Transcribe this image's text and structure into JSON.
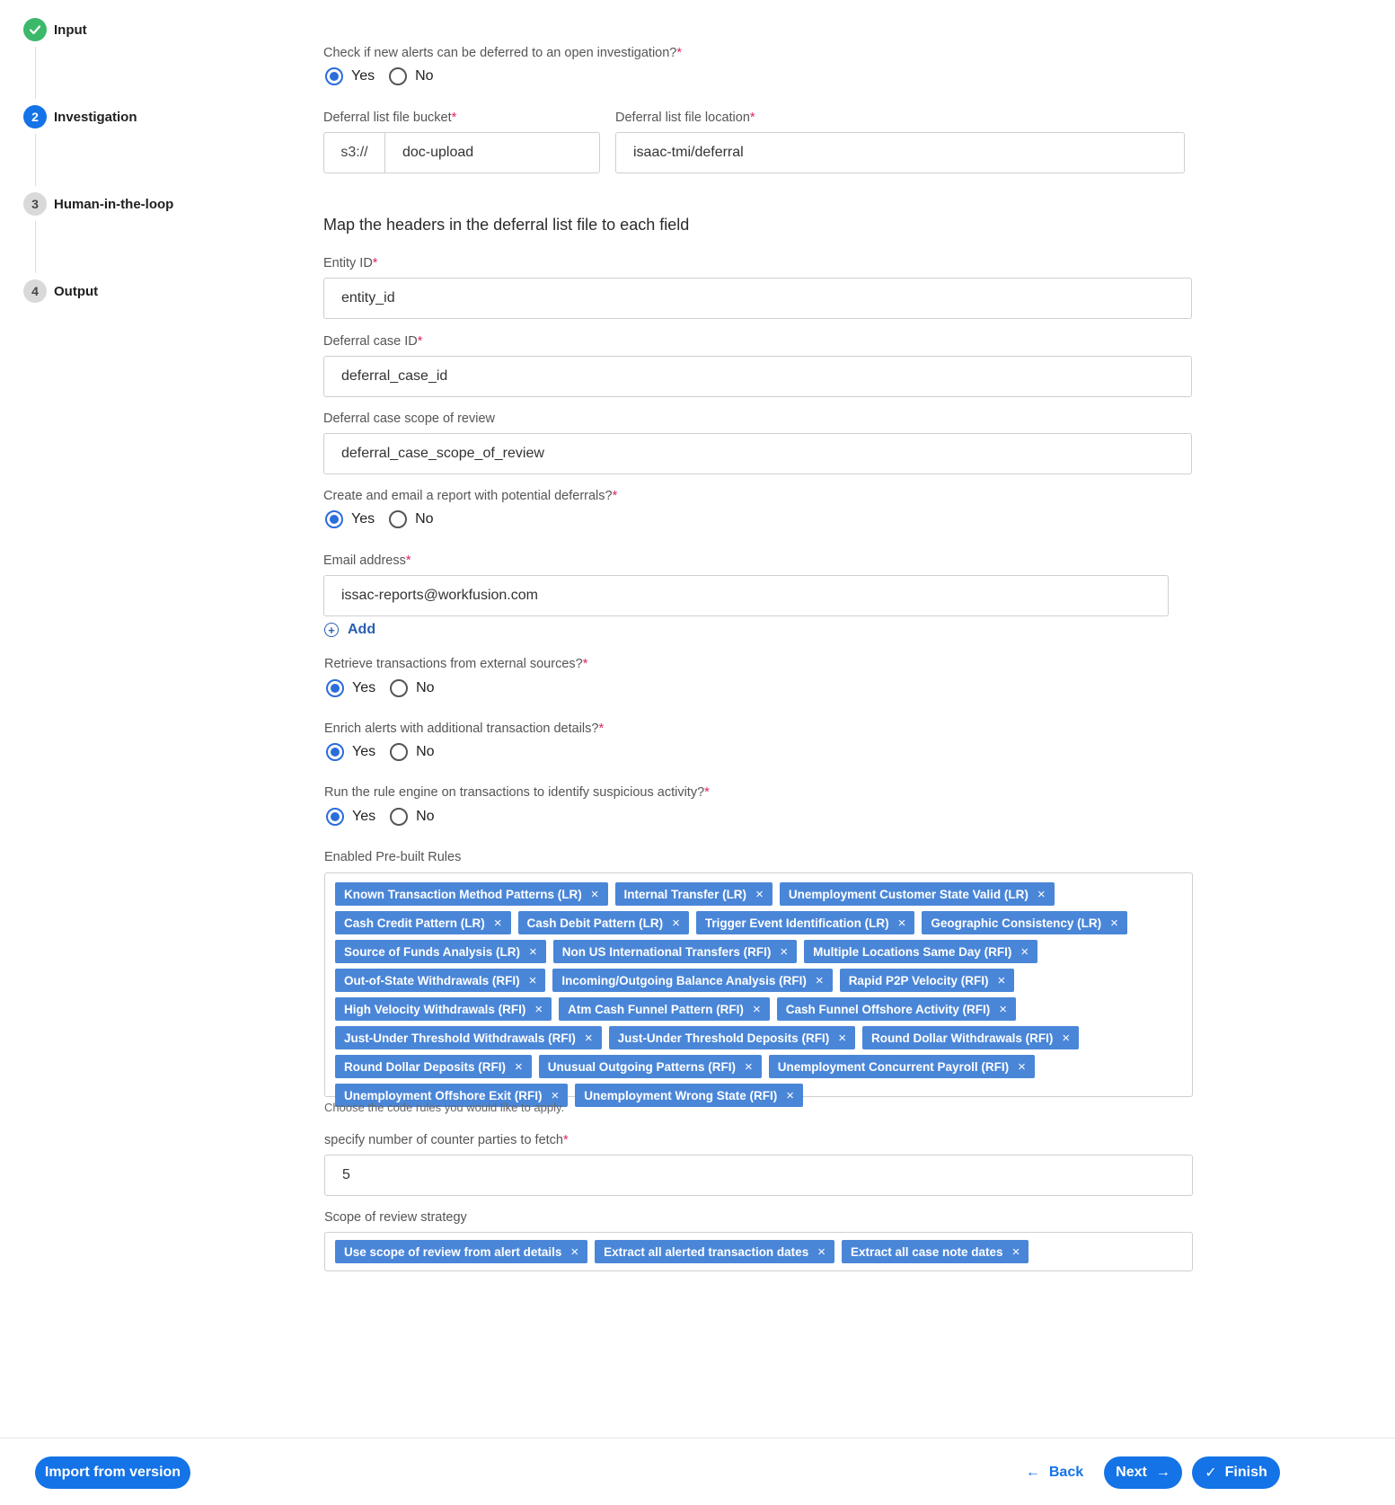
{
  "stepper": {
    "steps": [
      {
        "number": "✓",
        "label": "Input",
        "state": "done"
      },
      {
        "number": "2",
        "label": "Investigation",
        "state": "active"
      },
      {
        "number": "3",
        "label": "Human-in-the-loop",
        "state": "pending"
      },
      {
        "number": "4",
        "label": "Output",
        "state": "pending"
      }
    ]
  },
  "form": {
    "defer_question": {
      "label": "Check if new alerts can be deferred to an open investigation?",
      "yes": "Yes",
      "no": "No",
      "selected": "Yes"
    },
    "bucket": {
      "label": "Deferral list file bucket",
      "prefix": "s3://",
      "value": "doc-upload"
    },
    "location": {
      "label": "Deferral list file location",
      "value": "isaac-tmi/deferral"
    },
    "map_title": "Map the headers in the deferral list file to each field",
    "entity_id": {
      "label": "Entity ID",
      "value": "entity_id"
    },
    "deferral_case_id": {
      "label": "Deferral case ID",
      "value": "deferral_case_id"
    },
    "deferral_scope": {
      "label": "Deferral case scope of review",
      "value": "deferral_case_scope_of_review"
    },
    "report_question": {
      "label": "Create and email a report with potential deferrals?",
      "yes": "Yes",
      "no": "No",
      "selected": "Yes"
    },
    "email": {
      "label": "Email address",
      "value": "issac-reports@workfusion.com"
    },
    "add_label": "Add",
    "retrieve_question": {
      "label": "Retrieve transactions from external sources?",
      "yes": "Yes",
      "no": "No",
      "selected": "Yes"
    },
    "enrich_question": {
      "label": "Enrich alerts with additional transaction details?",
      "yes": "Yes",
      "no": "No",
      "selected": "Yes"
    },
    "rule_question": {
      "label": "Run the rule engine on transactions to identify suspicious activity?",
      "yes": "Yes",
      "no": "No",
      "selected": "Yes"
    },
    "rules": {
      "label": "Enabled Pre-built Rules",
      "helper": "Choose the code rules you would like to apply.",
      "items": [
        "Known Transaction Method Patterns (LR)",
        "Internal Transfer (LR)",
        "Unemployment Customer State Valid (LR)",
        "Cash Credit Pattern (LR)",
        "Cash Debit Pattern (LR)",
        "Trigger Event Identification (LR)",
        "Geographic Consistency (LR)",
        "Source of Funds Analysis (LR)",
        "Non US International Transfers (RFI)",
        "Multiple Locations Same Day (RFI)",
        "Out-of-State Withdrawals (RFI)",
        "Incoming/Outgoing Balance Analysis (RFI)",
        "Rapid P2P Velocity (RFI)",
        "High Velocity Withdrawals (RFI)",
        "Atm Cash Funnel Pattern (RFI)",
        "Cash Funnel Offshore Activity (RFI)",
        "Just-Under Threshold Withdrawals (RFI)",
        "Just-Under Threshold Deposits (RFI)",
        "Round Dollar Withdrawals (RFI)",
        "Round Dollar Deposits (RFI)",
        "Unusual Outgoing Patterns (RFI)",
        "Unemployment Concurrent Payroll (RFI)",
        "Unemployment Offshore Exit (RFI)",
        "Unemployment Wrong State (RFI)"
      ]
    },
    "counter_parties": {
      "label": "specify number of counter parties to fetch",
      "value": "5"
    },
    "scope_strategy": {
      "label": "Scope of review strategy",
      "items": [
        "Use scope of review from alert details",
        "Extract all alerted transaction dates",
        "Extract all case note dates"
      ]
    }
  },
  "footer": {
    "import_label": "Import from version",
    "back_label": "Back",
    "next_label": "Next",
    "finish_label": "Finish"
  },
  "colors": {
    "primary": "#1473e6",
    "tag": "#4a86d8",
    "done": "#3bb86a",
    "required": "#e0245e"
  }
}
